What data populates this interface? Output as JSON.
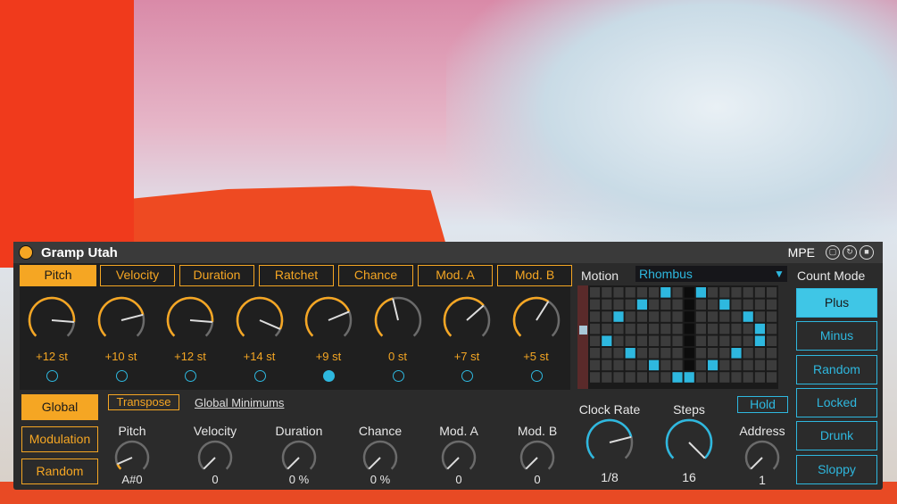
{
  "device": {
    "title": "Gramp Utah",
    "mpe_label": "MPE"
  },
  "tabs": [
    "Pitch",
    "Velocity",
    "Duration",
    "Ratchet",
    "Chance",
    "Mod. A",
    "Mod. B"
  ],
  "active_tab": "Pitch",
  "steps": [
    {
      "value": "+12 st",
      "knob": 0.85,
      "active": false
    },
    {
      "value": "+10 st",
      "knob": 0.78,
      "active": false
    },
    {
      "value": "+12 st",
      "knob": 0.85,
      "active": false
    },
    {
      "value": "+14 st",
      "knob": 0.92,
      "active": false
    },
    {
      "value": "+9 st",
      "knob": 0.75,
      "active": false
    },
    {
      "value": "0 st",
      "knob": 0.45,
      "active": false
    },
    {
      "value": "+7 st",
      "knob": 0.68,
      "active": false
    },
    {
      "value": "+5 st",
      "knob": 0.62,
      "active": false
    }
  ],
  "active_step_index": 4,
  "side_buttons": [
    "Global",
    "Modulation",
    "Random"
  ],
  "active_side": "Global",
  "transpose_label": "Transpose",
  "global_minimums_label": "Global Minimums",
  "params": [
    {
      "label": "Pitch",
      "value": "A#0",
      "knob": 0.08,
      "accent": "#f5a623"
    },
    {
      "label": "Velocity",
      "value": "0",
      "knob": 0.0,
      "accent": "#f5a623"
    },
    {
      "label": "Duration",
      "value": "0 %",
      "knob": 0.0,
      "accent": "#f5a623"
    },
    {
      "label": "Chance",
      "value": "0 %",
      "knob": 0.0,
      "accent": "#f5a623"
    },
    {
      "label": "Mod. A",
      "value": "0",
      "knob": 0.0,
      "accent": "#f5a623"
    },
    {
      "label": "Mod. B",
      "value": "0",
      "knob": 0.0,
      "accent": "#f5a623"
    }
  ],
  "motion": {
    "label": "Motion",
    "selected": "Rhombus",
    "grid_cols": 16,
    "grid_rows": 8,
    "lit": [
      [
        6,
        0
      ],
      [
        9,
        0
      ],
      [
        4,
        1
      ],
      [
        11,
        1
      ],
      [
        2,
        2
      ],
      [
        13,
        2
      ],
      [
        14,
        3
      ],
      [
        1,
        4
      ],
      [
        14,
        4
      ],
      [
        3,
        5
      ],
      [
        12,
        5
      ],
      [
        5,
        6
      ],
      [
        10,
        6
      ],
      [
        7,
        7
      ],
      [
        8,
        7
      ]
    ]
  },
  "clock": [
    {
      "label": "Clock Rate",
      "value": "1/8",
      "knob": 0.78,
      "accent": "#2eb8df"
    },
    {
      "label": "Steps",
      "value": "16",
      "knob": 1.0,
      "accent": "#2eb8df"
    },
    {
      "label": "Address",
      "value": "1",
      "knob": 0.0,
      "accent": "#2eb8df"
    }
  ],
  "hold_label": "Hold",
  "count_mode": {
    "label": "Count Mode",
    "options": [
      "Plus",
      "Minus",
      "Random",
      "Locked",
      "Drunk",
      "Sloppy"
    ],
    "selected": "Plus"
  },
  "colors": {
    "accent": "#f5a623",
    "cyan": "#2eb8df",
    "panel": "#2b2b2b"
  }
}
